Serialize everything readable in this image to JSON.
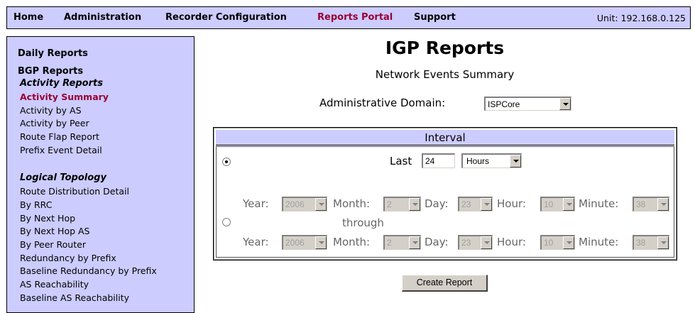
{
  "nav": {
    "items": [
      "Home",
      "Administration",
      "Recorder Configuration",
      "Reports Portal",
      "Support"
    ],
    "active": "Reports Portal",
    "unit": "Unit: 192.168.0.125"
  },
  "sidebar": {
    "daily_reports": "Daily Reports",
    "bgp_reports": "BGP Reports",
    "activity_reports": "Activity Reports",
    "activity_items": [
      "Activity Summary",
      "Activity by AS",
      "Activity by Peer",
      "Route Flap Report",
      "Prefix Event Detail"
    ],
    "logical_topology": "Logical Topology",
    "topology_items": [
      "Route Distribution Detail",
      "By RRC",
      "By Next Hop",
      "By Next Hop AS",
      "By Peer Router",
      "Redundancy by Prefix",
      "Baseline Redundancy by Prefix",
      "AS Reachability",
      "Baseline AS Reachability"
    ]
  },
  "main": {
    "title": "IGP Reports",
    "subtitle": "Network Events Summary",
    "domain_label": "Administrative Domain:",
    "domain_value": "ISPCore",
    "interval_header": "Interval",
    "last_label": "Last",
    "last_value": "24",
    "last_unit": "Hours",
    "through_label": "through",
    "from": {
      "year": "2006",
      "month": "2",
      "day": "23",
      "hour": "10",
      "minute": "38"
    },
    "to": {
      "year": "2006",
      "month": "2",
      "day": "23",
      "hour": "10",
      "minute": "38"
    },
    "labels": {
      "year": "Year:",
      "month": "Month:",
      "day": "Day:",
      "hour": "Hour:",
      "minute": "Minute:"
    },
    "create_button": "Create Report"
  }
}
